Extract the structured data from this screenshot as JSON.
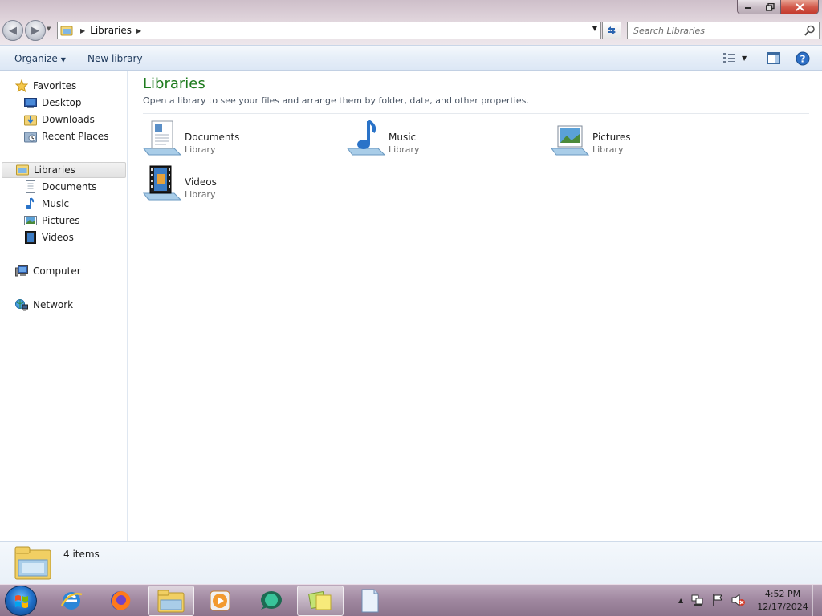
{
  "window": {
    "address": {
      "path": [
        "Libraries"
      ]
    },
    "search": {
      "placeholder": "Search Libraries"
    }
  },
  "toolbar": {
    "organize_label": "Organize",
    "new_library_label": "New library"
  },
  "navigation": {
    "favorites": {
      "label": "Favorites",
      "items": [
        {
          "label": "Desktop",
          "icon": "desktop-icon"
        },
        {
          "label": "Downloads",
          "icon": "downloads-folder-icon"
        },
        {
          "label": "Recent Places",
          "icon": "recent-places-icon"
        }
      ]
    },
    "libraries": {
      "label": "Libraries",
      "selected": true,
      "items": [
        {
          "label": "Documents",
          "icon": "documents-icon"
        },
        {
          "label": "Music",
          "icon": "music-icon"
        },
        {
          "label": "Pictures",
          "icon": "pictures-icon"
        },
        {
          "label": "Videos",
          "icon": "videos-icon"
        }
      ]
    },
    "computer": {
      "label": "Computer"
    },
    "network": {
      "label": "Network"
    }
  },
  "content": {
    "title": "Libraries",
    "subtitle": "Open a library to see your files and arrange them by folder, date, and other properties.",
    "libraries": [
      {
        "name": "Documents",
        "type": "Library",
        "icon": "documents-library-icon"
      },
      {
        "name": "Music",
        "type": "Library",
        "icon": "music-library-icon"
      },
      {
        "name": "Pictures",
        "type": "Library",
        "icon": "pictures-library-icon"
      },
      {
        "name": "Videos",
        "type": "Library",
        "icon": "videos-library-icon"
      }
    ]
  },
  "details": {
    "item_count": "4 items"
  },
  "taskbar": {
    "pinned": [
      "internet-explorer-icon",
      "firefox-icon",
      "windows-explorer-icon",
      "media-player-icon",
      "chat-app-icon",
      "sticky-notes-icon",
      "notepad-icon"
    ],
    "clock": {
      "time": "4:52 PM",
      "date": "12/17/2024"
    }
  },
  "colors": {
    "title_green": "#1e7b1e",
    "toolbar_text": "#1e395b",
    "close_button_red": "#c1362a"
  }
}
